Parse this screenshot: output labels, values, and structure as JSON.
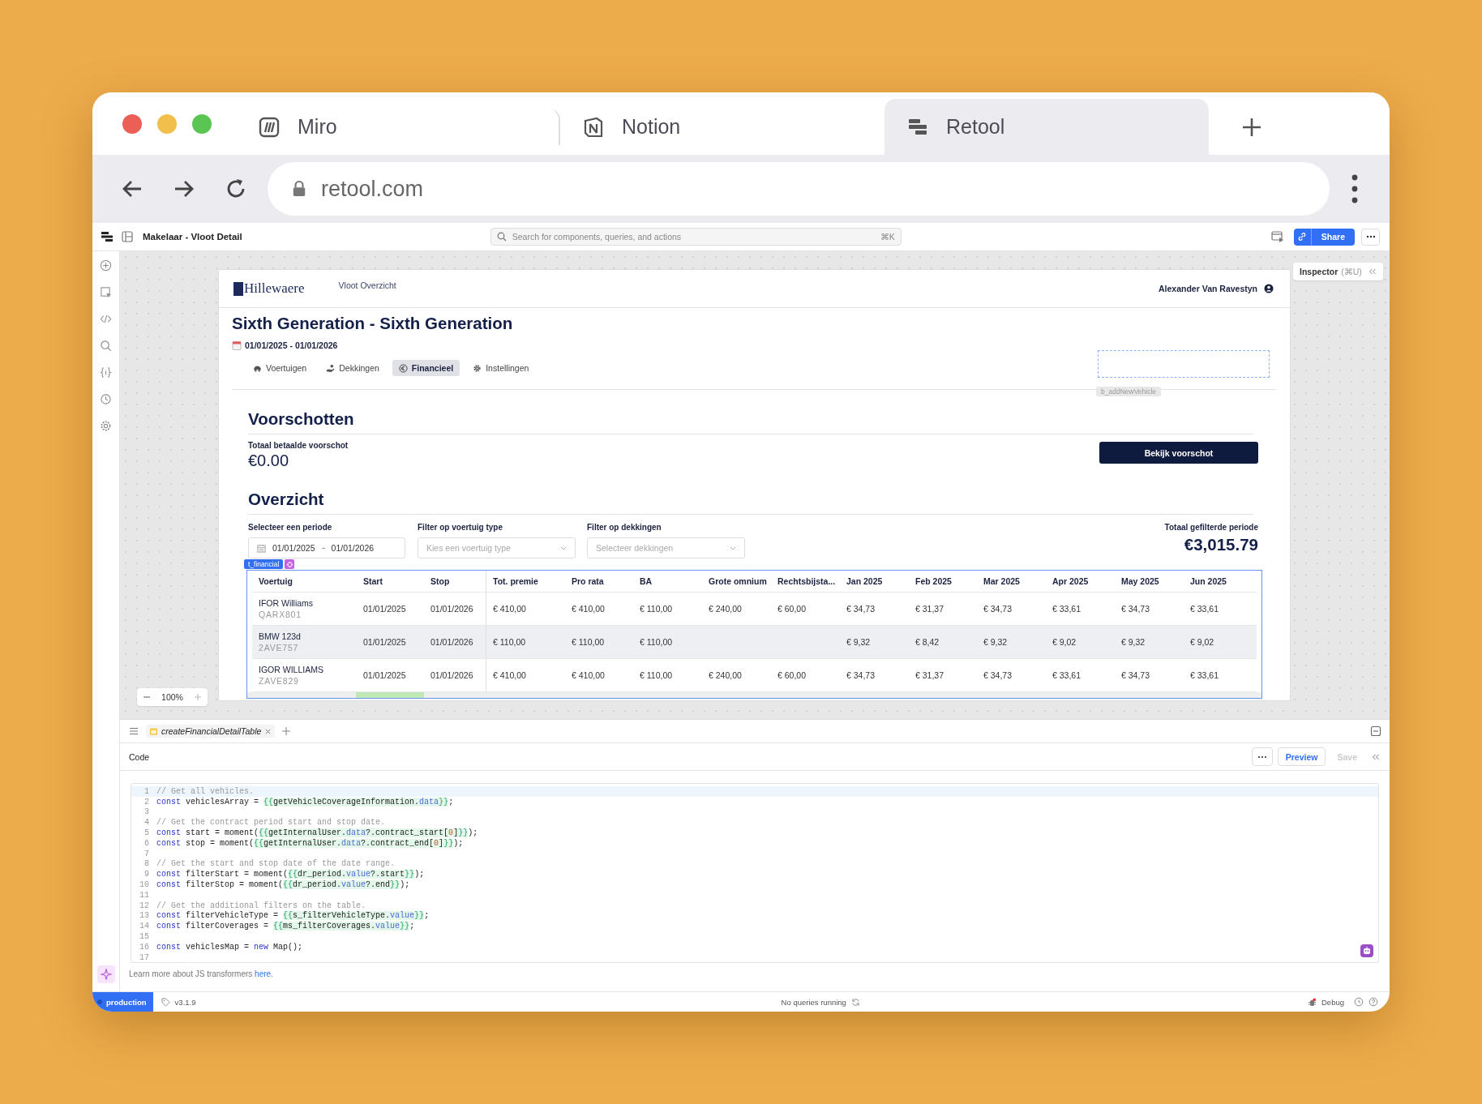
{
  "browser": {
    "tabs": [
      {
        "label": "Miro",
        "selected": false
      },
      {
        "label": "Notion",
        "selected": false
      },
      {
        "label": "Retool",
        "selected": true
      }
    ],
    "url": "retool.com"
  },
  "app_header": {
    "title": "Makelaar - Vloot Detail",
    "search_placeholder": "Search for components, queries, and actions",
    "search_shortcut": "⌘K",
    "share": "Share"
  },
  "inspector": {
    "label": "Inspector",
    "shortcut": "(⌘U)"
  },
  "page": {
    "logo": "Hillewaere",
    "nav_link": "Vloot Overzicht",
    "user": "Alexander Van Ravestyn",
    "title": "Sixth Generation - Sixth Generation",
    "date_range": "01/01/2025 - 01/01/2026",
    "tabs": [
      {
        "label": "Voertuigen",
        "selected": false
      },
      {
        "label": "Dekkingen",
        "selected": false
      },
      {
        "label": "Financieel",
        "selected": true
      },
      {
        "label": "Instellingen",
        "selected": false
      }
    ],
    "placeholder_component": "b_addNewVehicle",
    "advances": {
      "heading": "Voorschotten",
      "label": "Totaal betaalde voorschot",
      "value": "€0.00",
      "button": "Bekijk voorschot"
    },
    "overview": {
      "heading": "Overzicht",
      "filters": [
        {
          "kind": "daterange",
          "label": "Selecteer een periode",
          "start": "01/01/2025",
          "end": "01/01/2026"
        },
        {
          "kind": "select",
          "label": "Filter op voertuig type",
          "placeholder": "Kies een voertuig type"
        },
        {
          "kind": "select",
          "label": "Filter op dekkingen",
          "placeholder": "Selecteer dekkingen"
        }
      ],
      "total_label": "Totaal gefilterde periode",
      "total_value": "€3,015.79"
    },
    "table": {
      "tag": "t_financial",
      "columns": [
        "Voertuig",
        "Start",
        "Stop",
        "Tot. premie",
        "Pro rata",
        "BA",
        "Grote omnium",
        "Rechtsbijsta...",
        "Jan 2025",
        "Feb 2025",
        "Mar 2025",
        "Apr 2025",
        "May 2025",
        "Jun 2025"
      ],
      "rows": [
        {
          "selected": false,
          "cells": [
            {
              "name": "IFOR Williams",
              "plate": "QARX801"
            },
            "01/01/2025",
            "01/01/2026",
            "€ 410,00",
            "€ 410,00",
            "€ 110,00",
            "€ 240,00",
            "€ 60,00",
            "€ 34,73",
            "€ 31,37",
            "€ 34,73",
            "€ 33,61",
            "€ 34,73",
            "€ 33,61"
          ]
        },
        {
          "selected": true,
          "cells": [
            {
              "name": "BMW 123d",
              "plate": "2AVE757"
            },
            "01/01/2025",
            "01/01/2026",
            "€ 110,00",
            "€ 110,00",
            "€ 110,00",
            "",
            "",
            "€ 9,32",
            "€ 8,42",
            "€ 9,32",
            "€ 9,02",
            "€ 9,32",
            "€ 9,02"
          ]
        },
        {
          "selected": false,
          "cells": [
            {
              "name": "IGOR WILLIAMS",
              "plate": "ZAVE829"
            },
            "01/01/2025",
            "01/01/2026",
            "€ 410,00",
            "€ 410,00",
            "€ 110,00",
            "€ 240,00",
            "€ 60,00",
            "€ 34,73",
            "€ 31,37",
            "€ 34,73",
            "€ 33,61",
            "€ 34,73",
            "€ 33,61"
          ]
        }
      ]
    }
  },
  "zoom": {
    "value": "100%"
  },
  "editor": {
    "tab": "createFinancialDetailTable",
    "section": "Code",
    "preview": "Preview",
    "save": "Save",
    "save_disabled": true,
    "lines": [
      {
        "n": "1",
        "tokens": [
          {
            "kind": "comment",
            "text": "// Get all vehicles."
          }
        ]
      },
      {
        "n": "2",
        "tokens": [
          {
            "kind": "keyword",
            "text": "const"
          },
          {
            "kind": "plain",
            "text": " vehiclesArray = "
          },
          {
            "kind": "brace",
            "text": "{{"
          },
          {
            "kind": "template",
            "text": "getVehicleCoverageInformation."
          },
          {
            "kind": "property",
            "text": "data"
          },
          {
            "kind": "brace",
            "text": "}}"
          },
          {
            "kind": "plain",
            "text": ";"
          }
        ]
      },
      {
        "n": "3"
      },
      {
        "n": "4",
        "tokens": [
          {
            "kind": "comment",
            "text": "// Get the contract period start and stop date."
          }
        ]
      },
      {
        "n": "5",
        "tokens": [
          {
            "kind": "keyword",
            "text": "const"
          },
          {
            "kind": "plain",
            "text": " start = moment("
          },
          {
            "kind": "brace",
            "text": "{{"
          },
          {
            "kind": "template",
            "text": "getInternalUser."
          },
          {
            "kind": "property",
            "text": "data"
          },
          {
            "kind": "template",
            "text": "?.contract_start["
          },
          {
            "kind": "number",
            "text": "0"
          },
          {
            "kind": "template",
            "text": "]"
          },
          {
            "kind": "brace",
            "text": "}}"
          },
          {
            "kind": "plain",
            "text": ");"
          }
        ]
      },
      {
        "n": "6",
        "tokens": [
          {
            "kind": "keyword",
            "text": "const"
          },
          {
            "kind": "plain",
            "text": " stop = moment("
          },
          {
            "kind": "brace",
            "text": "{{"
          },
          {
            "kind": "template",
            "text": "getInternalUser."
          },
          {
            "kind": "property",
            "text": "data"
          },
          {
            "kind": "template",
            "text": "?.contract_end["
          },
          {
            "kind": "number",
            "text": "0"
          },
          {
            "kind": "template",
            "text": "]"
          },
          {
            "kind": "brace",
            "text": "}}"
          },
          {
            "kind": "plain",
            "text": ");"
          }
        ]
      },
      {
        "n": "7"
      },
      {
        "n": "8",
        "tokens": [
          {
            "kind": "comment",
            "text": "// Get the start and stop date of the date range."
          }
        ]
      },
      {
        "n": "9",
        "tokens": [
          {
            "kind": "keyword",
            "text": "const"
          },
          {
            "kind": "plain",
            "text": " filterStart = moment("
          },
          {
            "kind": "brace",
            "text": "{{"
          },
          {
            "kind": "template",
            "text": "dr_period."
          },
          {
            "kind": "property",
            "text": "value"
          },
          {
            "kind": "template",
            "text": "?.start"
          },
          {
            "kind": "brace",
            "text": "}}"
          },
          {
            "kind": "plain",
            "text": ");"
          }
        ]
      },
      {
        "n": "10",
        "tokens": [
          {
            "kind": "keyword",
            "text": "const"
          },
          {
            "kind": "plain",
            "text": " filterStop = moment("
          },
          {
            "kind": "brace",
            "text": "{{"
          },
          {
            "kind": "template",
            "text": "dr_period."
          },
          {
            "kind": "property",
            "text": "value"
          },
          {
            "kind": "template",
            "text": "?.end"
          },
          {
            "kind": "brace",
            "text": "}}"
          },
          {
            "kind": "plain",
            "text": ");"
          }
        ]
      },
      {
        "n": "11"
      },
      {
        "n": "12",
        "tokens": [
          {
            "kind": "comment",
            "text": "// Get the additional filters on the table."
          }
        ]
      },
      {
        "n": "13",
        "tokens": [
          {
            "kind": "keyword",
            "text": "const"
          },
          {
            "kind": "plain",
            "text": " filterVehicleType = "
          },
          {
            "kind": "brace",
            "text": "{{"
          },
          {
            "kind": "template",
            "text": "s_filterVehicleType."
          },
          {
            "kind": "property",
            "text": "value"
          },
          {
            "kind": "brace",
            "text": "}}"
          },
          {
            "kind": "plain",
            "text": ";"
          }
        ]
      },
      {
        "n": "14",
        "tokens": [
          {
            "kind": "keyword",
            "text": "const"
          },
          {
            "kind": "plain",
            "text": " filterCoverages = "
          },
          {
            "kind": "brace",
            "text": "{{"
          },
          {
            "kind": "template",
            "text": "ms_filterCoverages."
          },
          {
            "kind": "property",
            "text": "value"
          },
          {
            "kind": "brace",
            "text": "}}"
          },
          {
            "kind": "plain",
            "text": ";"
          }
        ]
      },
      {
        "n": "15"
      },
      {
        "n": "16",
        "tokens": [
          {
            "kind": "keyword",
            "text": "const"
          },
          {
            "kind": "plain",
            "text": " vehiclesMap = "
          },
          {
            "kind": "keyword",
            "text": "new"
          },
          {
            "kind": "plain",
            "text": " Map();"
          }
        ]
      },
      {
        "n": "17"
      }
    ],
    "help_text": "Learn more about JS transformers",
    "help_link": "here",
    "help_end": "."
  },
  "status_bar": {
    "environment": "production",
    "version": "v3.1.9",
    "queries": "No queries running",
    "debug": "Debug"
  }
}
